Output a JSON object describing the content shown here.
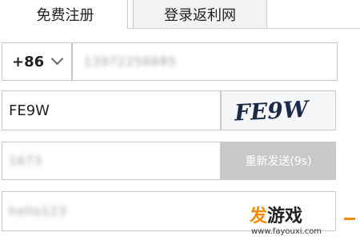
{
  "tabs": [
    {
      "label": "免费注册",
      "active": true
    },
    {
      "label": "登录返利网",
      "active": false
    }
  ],
  "phone": {
    "country_code": "+86",
    "number_blurred": "13972256685"
  },
  "captcha": {
    "input_value": "FE9W",
    "image_text": "FE9W"
  },
  "sms": {
    "code_blurred": "1673",
    "resend_label": "重新发送(9s)"
  },
  "nickname": {
    "value_blurred": "hello123"
  },
  "watermark": {
    "brand_part1": "发",
    "brand_part2": "游戏",
    "url": "www.fayouxi.com"
  },
  "colors": {
    "accent_orange": "#f28c00",
    "disabled_button": "#c8c8c8",
    "border": "#c9c9c9"
  }
}
